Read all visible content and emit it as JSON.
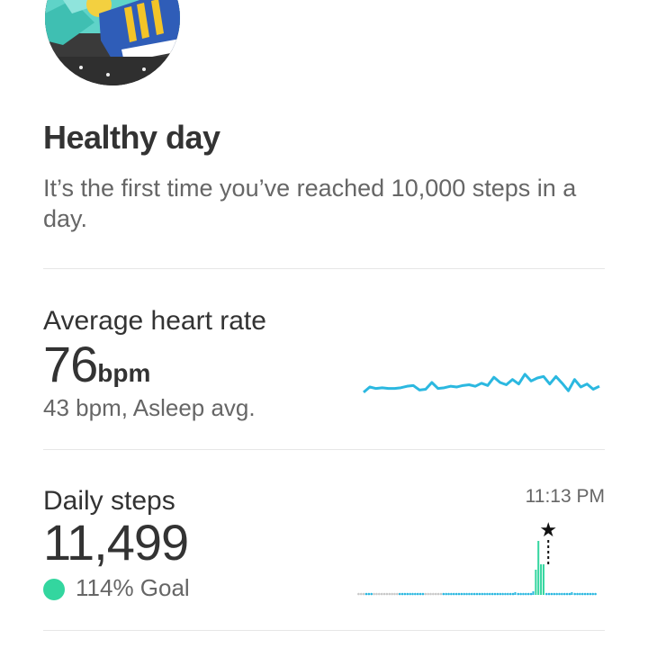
{
  "achievement": {
    "title": "Healthy day",
    "description": "It’s the first time you’ve reached 10,000 steps in a day.",
    "image_icon": "sneaker-illustration"
  },
  "heart_rate": {
    "label": "Average heart rate",
    "value": "76",
    "unit": "bpm",
    "sub": "43 bpm, Asleep avg.",
    "color": "#2bb8e0",
    "trend": [
      55,
      48,
      50,
      49,
      50,
      50,
      49,
      47,
      46,
      52,
      51,
      42,
      50,
      49,
      47,
      48,
      46,
      45,
      47,
      43,
      46,
      35,
      42,
      45,
      38,
      44,
      31,
      40,
      36,
      34,
      44,
      34,
      43,
      53,
      38,
      48,
      44,
      51,
      47
    ]
  },
  "daily_steps": {
    "label": "Daily steps",
    "value": "11,499",
    "goal_text": "114% Goal",
    "goal_color": "#33d69f",
    "dot_color": "#2bb8e0",
    "highlight_time": "11:13 PM",
    "marker_icon": "star-icon",
    "bars": [
      0,
      0,
      0,
      0,
      0,
      0,
      0,
      0,
      0,
      0,
      0,
      0,
      0,
      0,
      0,
      0,
      0,
      0,
      0,
      0,
      0,
      0,
      0,
      0,
      0,
      0,
      0,
      0,
      0,
      0,
      0,
      0,
      0,
      0,
      0,
      0,
      0,
      0,
      0,
      0,
      0,
      0,
      0,
      0,
      0,
      0,
      0,
      0,
      0,
      0,
      0,
      0,
      0,
      0,
      0,
      0,
      0,
      0,
      0,
      0,
      0,
      1,
      0,
      0,
      0,
      0,
      0,
      0,
      4,
      28,
      60,
      34,
      34,
      0,
      0,
      0,
      0,
      0,
      0,
      0,
      0,
      0,
      0,
      3,
      0,
      0,
      0,
      0,
      0,
      0,
      0,
      0,
      0
    ],
    "gray_ranges": [
      [
        0,
        2
      ],
      [
        6,
        15
      ],
      [
        26,
        32
      ]
    ]
  }
}
